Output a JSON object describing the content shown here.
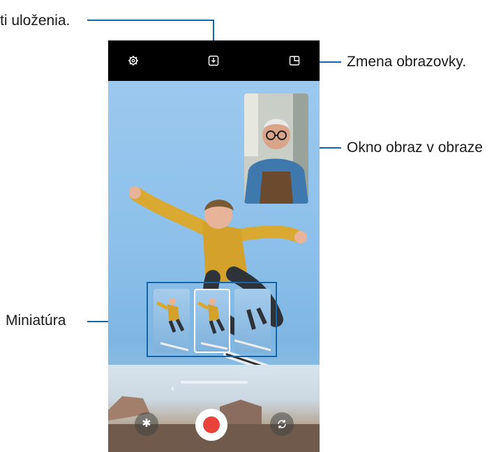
{
  "callouts": {
    "top_left": "ti uloženia.",
    "switch_screen": "Zmena obrazovky.",
    "pip_window": "Okno obraz v obraze",
    "thumbnail": "Miniatúra"
  },
  "icons": {
    "settings": "gear-icon",
    "save": "download-icon",
    "switch_screen": "split-screen-icon",
    "effects": "flower-icon",
    "flip_camera": "camera-switch-icon"
  },
  "colors": {
    "callout_line": "#1565a8",
    "record": "#e8423a",
    "topbar": "#000000"
  },
  "hint": {
    "arrow": "‹"
  }
}
